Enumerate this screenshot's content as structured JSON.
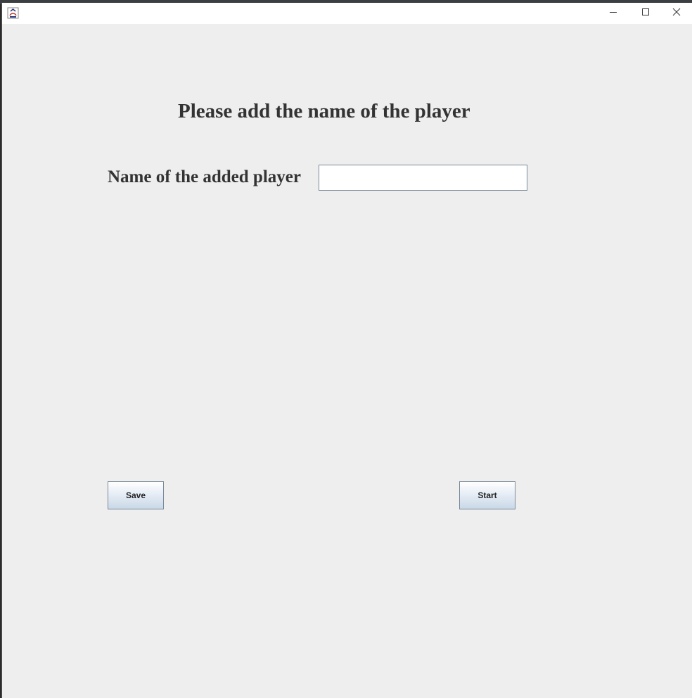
{
  "window": {
    "title": "",
    "icon": "java-app-icon",
    "controls": {
      "minimize_icon": "minimize-icon",
      "maximize_icon": "maximize-icon",
      "close_icon": "close-icon"
    }
  },
  "form": {
    "heading": "Please add the name of the player",
    "name_label": "Name of the added player",
    "name_value": "",
    "save_label": "Save",
    "start_label": "Start"
  },
  "colors": {
    "background": "#eeeeee",
    "text": "#333333",
    "button_gradient_top": "#ffffff",
    "button_gradient_bottom": "#c9d8e7",
    "border": "#7a8a99"
  }
}
